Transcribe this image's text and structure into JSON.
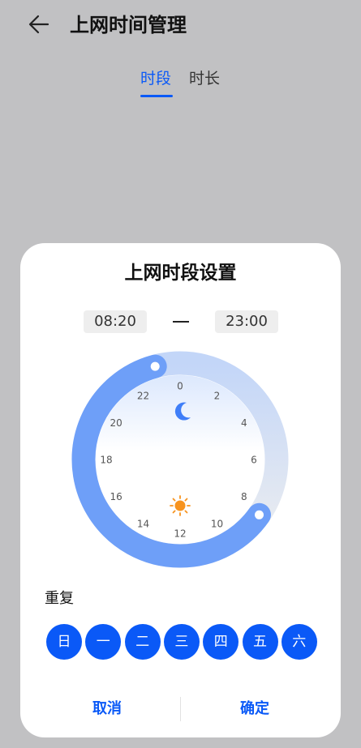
{
  "header": {
    "title": "上网时间管理"
  },
  "tabs": [
    {
      "label": "时段",
      "active": true
    },
    {
      "label": "时长",
      "active": false
    }
  ],
  "dialog": {
    "title": "上网时段设置",
    "start_time": "08:20",
    "end_time": "23:00",
    "clock_labels": [
      "0",
      "2",
      "4",
      "6",
      "8",
      "10",
      "12",
      "14",
      "16",
      "18",
      "20",
      "22"
    ],
    "repeat_label": "重复",
    "days": [
      "日",
      "一",
      "二",
      "三",
      "四",
      "五",
      "六"
    ],
    "cancel_label": "取消",
    "confirm_label": "确定"
  },
  "icons": {
    "back": "arrow-left-icon",
    "night": "moon-icon",
    "day": "sun-icon"
  },
  "colors": {
    "accent": "#0a59f7",
    "arc": "#6e9ff8",
    "overlay": "#c1c1c3",
    "sun": "#f7931e"
  }
}
